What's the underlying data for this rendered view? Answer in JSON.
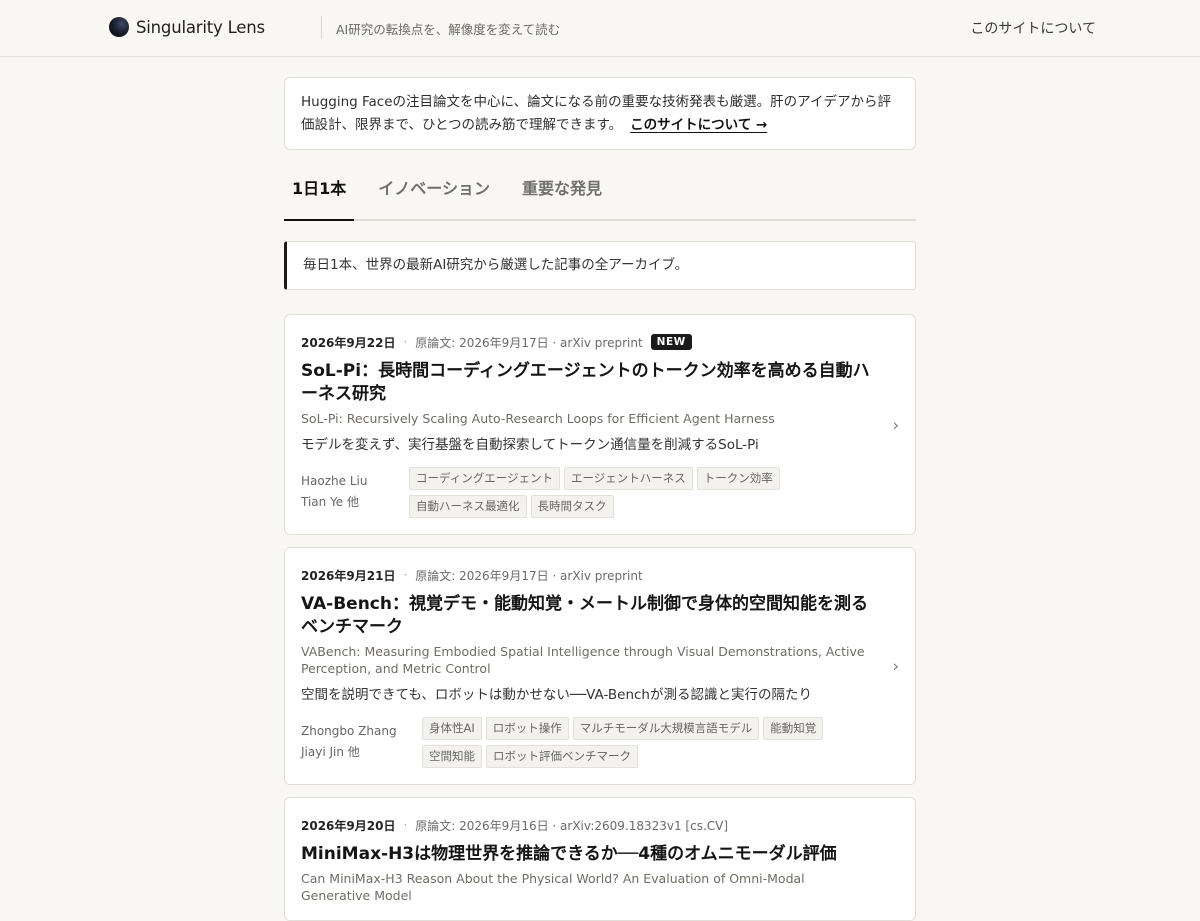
{
  "header": {
    "brand": "Singularity Lens",
    "tagline": "AI研究の転換点を、解像度を変えて読む",
    "about": "このサイトについて"
  },
  "intro": {
    "text": "Hugging Faceの注目論文を中心に、論文になる前の重要な技術発表も厳選。肝のアイデアから評価設計、限界まで、ひとつの読み筋で理解できます。",
    "link": "このサイトについて →"
  },
  "tabs": [
    {
      "label": "1日1本",
      "active": true
    },
    {
      "label": "イノベーション",
      "active": false
    },
    {
      "label": "重要な発見",
      "active": false
    }
  ],
  "archive_note": "毎日1本、世界の最新AI研究から厳選した記事の全アーカイブ。",
  "articles": [
    {
      "date": "2026年9月22日",
      "orig": "原論文: 2026年9月17日 · arXiv preprint",
      "badge": "NEW",
      "title": "SoL-Pi：長時間コーディングエージェントのトークン効率を高める自動ハーネス研究",
      "subtitle": "SoL-Pi: Recursively Scaling Auto-Research Loops for Efficient Agent Harness",
      "summary": "モデルを変えず、実行基盤を自動探索してトークン通信量を削減するSoL-Pi",
      "authors": "Haozhe Liu Tian Ye 他",
      "tags": [
        "コーディングエージェント",
        "エージェントハーネス",
        "トークン効率",
        "自動ハーネス最適化",
        "長時間タスク"
      ]
    },
    {
      "date": "2026年9月21日",
      "orig": "原論文: 2026年9月17日 · arXiv preprint",
      "title": "VA-Bench：視覚デモ・能動知覚・メートル制御で身体的空間知能を測るベンチマーク",
      "subtitle": "VABench: Measuring Embodied Spatial Intelligence through Visual Demonstrations, Active Perception, and Metric Control",
      "summary": "空間を説明できても、ロボットは動かせない──VA-Benchが測る認識と実行の隔たり",
      "authors": "Zhongbo Zhang Jiayi Jin 他",
      "tags": [
        "身体性AI",
        "ロボット操作",
        "マルチモーダル大規模言語モデル",
        "能動知覚",
        "空間知能",
        "ロボット評価ベンチマーク"
      ]
    },
    {
      "date": "2026年9月20日",
      "orig": "原論文: 2026年9月16日 · arXiv:2609.18323v1 [cs.CV]",
      "title": "MiniMax-H3は物理世界を推論できるか──4種のオムニモーダル評価",
      "subtitle": "Can MiniMax-H3 Reason About the Physical World? An Evaluation of Omni-Modal Generative Model"
    }
  ],
  "icons": {
    "chevron": "chevron-right-icon",
    "logo": "brand-logo-icon"
  },
  "colors": {
    "background": "#f8f7f3",
    "accent": "#1a1a1a"
  }
}
